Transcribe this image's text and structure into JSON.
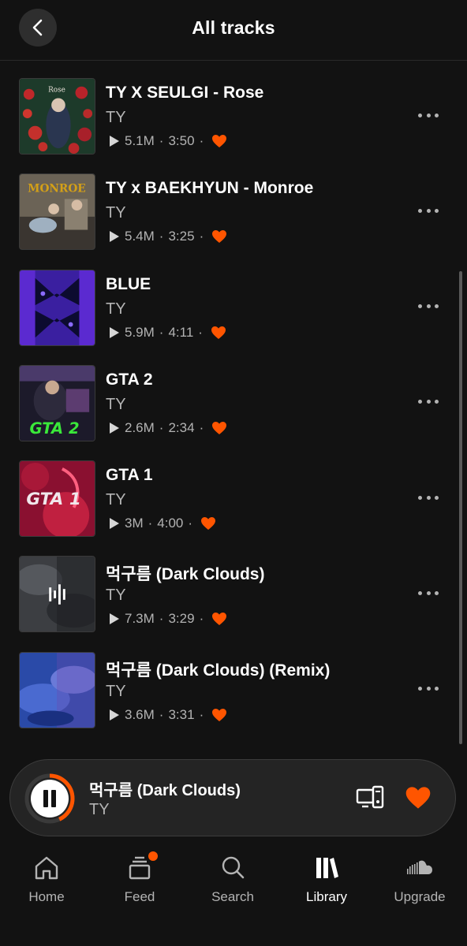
{
  "header": {
    "title": "All tracks"
  },
  "accent_color": "#ff5500",
  "tracks": [
    {
      "title": "TY X SEULGI - Rose",
      "artist": "TY",
      "plays": "5.1M",
      "duration": "3:50",
      "liked": true
    },
    {
      "title": "TY x BAEKHYUN - Monroe",
      "artist": "TY",
      "plays": "5.4M",
      "duration": "3:25",
      "liked": true
    },
    {
      "title": "BLUE",
      "artist": "TY",
      "plays": "5.9M",
      "duration": "4:11",
      "liked": true
    },
    {
      "title": "GTA 2",
      "artist": "TY",
      "plays": "2.6M",
      "duration": "2:34",
      "liked": true
    },
    {
      "title": "GTA 1",
      "artist": "TY",
      "plays": "3M",
      "duration": "4:00",
      "liked": true
    },
    {
      "title": "먹구름 (Dark Clouds)",
      "artist": "TY",
      "plays": "7.3M",
      "duration": "3:29",
      "liked": true
    },
    {
      "title": "먹구름 (Dark Clouds) (Remix)",
      "artist": "TY",
      "plays": "3.6M",
      "duration": "3:31",
      "liked": true
    }
  ],
  "artwork_text": {
    "rose": "Rose",
    "monroe": "MONROE",
    "gta2": "GTA 2",
    "gta1": "GTA 1"
  },
  "player": {
    "title": "먹구름 (Dark Clouds)",
    "artist": "TY",
    "progress": 0.43,
    "liked": true
  },
  "nav": {
    "items": [
      {
        "label": "Home",
        "icon": "home-icon"
      },
      {
        "label": "Feed",
        "icon": "feed-icon",
        "badge": true
      },
      {
        "label": "Search",
        "icon": "search-icon"
      },
      {
        "label": "Library",
        "icon": "library-icon",
        "active": true
      },
      {
        "label": "Upgrade",
        "icon": "soundcloud-icon"
      }
    ]
  }
}
